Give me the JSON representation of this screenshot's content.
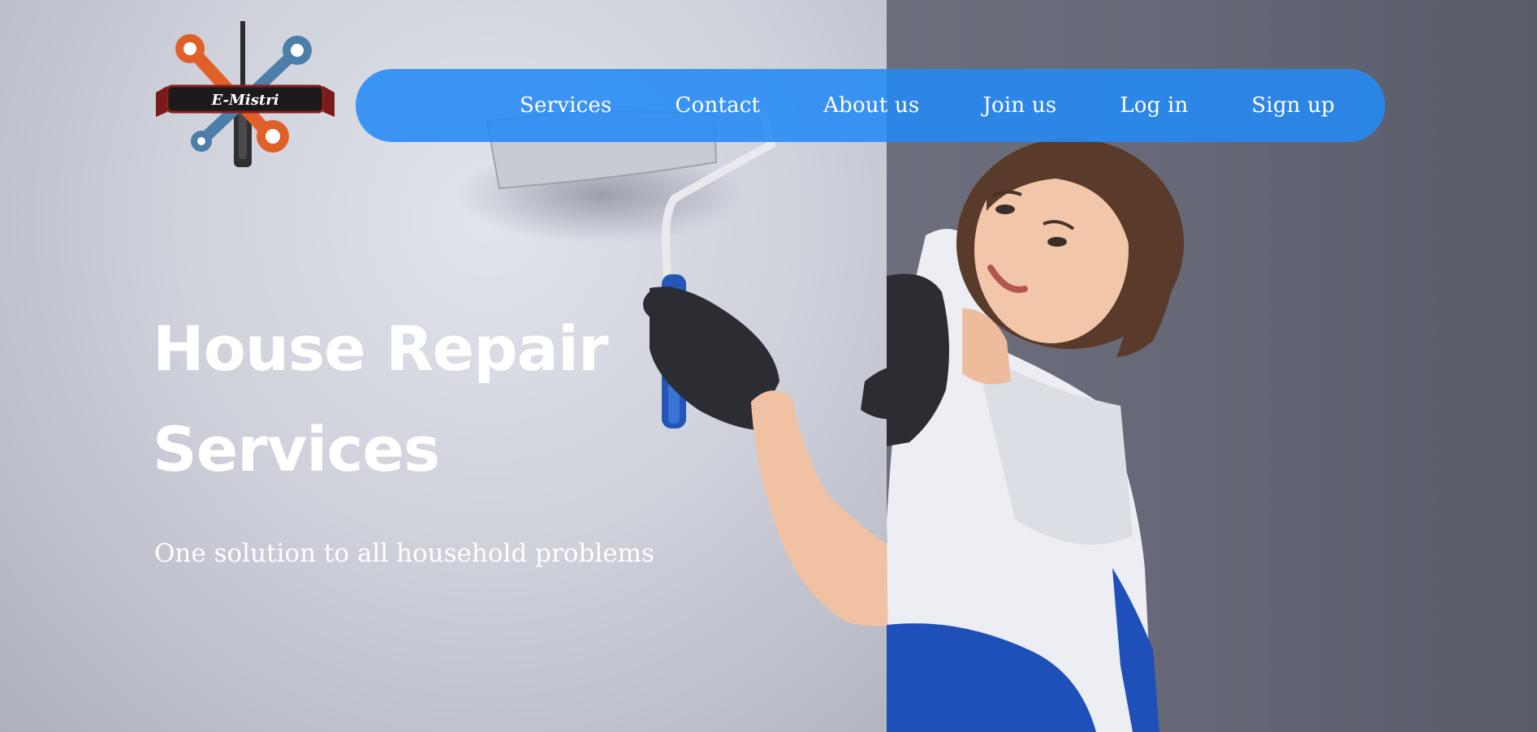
{
  "logo": {
    "text": "E-Mistri"
  },
  "nav": {
    "items": [
      {
        "label": "Services"
      },
      {
        "label": "Contact"
      },
      {
        "label": "About us"
      },
      {
        "label": "Join us"
      },
      {
        "label": "Log in"
      },
      {
        "label": "Sign up"
      }
    ]
  },
  "hero": {
    "title_line1": "House Repair",
    "title_line2": "Services",
    "subtitle": "One solution to all household problems"
  },
  "colors": {
    "nav_bg": "#248af5",
    "text": "#ffffff",
    "glove": "#2b2d33",
    "overalls": "#1f4fb8"
  },
  "icons": [
    "wrench-icon",
    "screwdriver-icon",
    "paint-roller-icon"
  ]
}
